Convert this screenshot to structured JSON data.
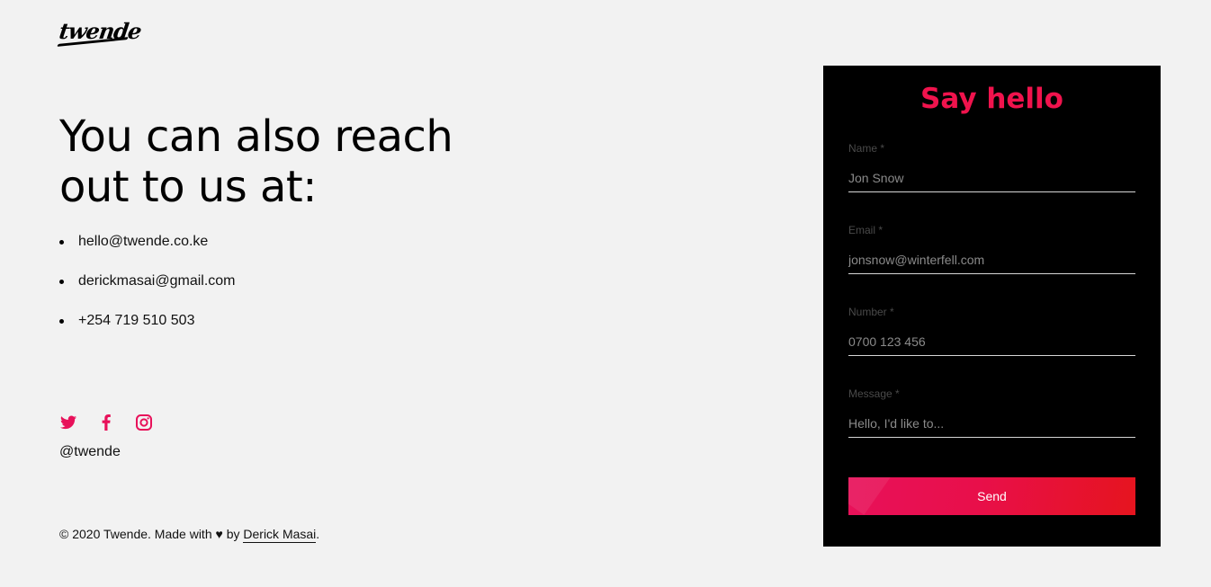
{
  "brand": {
    "logo_text": "twende",
    "accent_color": "#f0134d"
  },
  "contact": {
    "heading": "You can also reach out to us at:",
    "items": [
      "hello@twende.co.ke",
      "derickmasai@gmail.com",
      "+254 719 510 503"
    ]
  },
  "social": {
    "icons": [
      "twitter-icon",
      "facebook-icon",
      "instagram-icon"
    ],
    "handle": "@twende"
  },
  "footer": {
    "prefix": "© 2020 Twende. Made with",
    "heart": "♥",
    "by": "by",
    "author_link": "Derick Masai",
    "suffix": "."
  },
  "form": {
    "title": "Say hello",
    "fields": [
      {
        "label": "Name *",
        "placeholder": "Jon Snow"
      },
      {
        "label": "Email *",
        "placeholder": "jonsnow@winterfell.com"
      },
      {
        "label": "Number *",
        "placeholder": "0700 123 456"
      },
      {
        "label": "Message *",
        "placeholder": "Hello, I'd like to..."
      }
    ],
    "submit_label": "Send"
  }
}
